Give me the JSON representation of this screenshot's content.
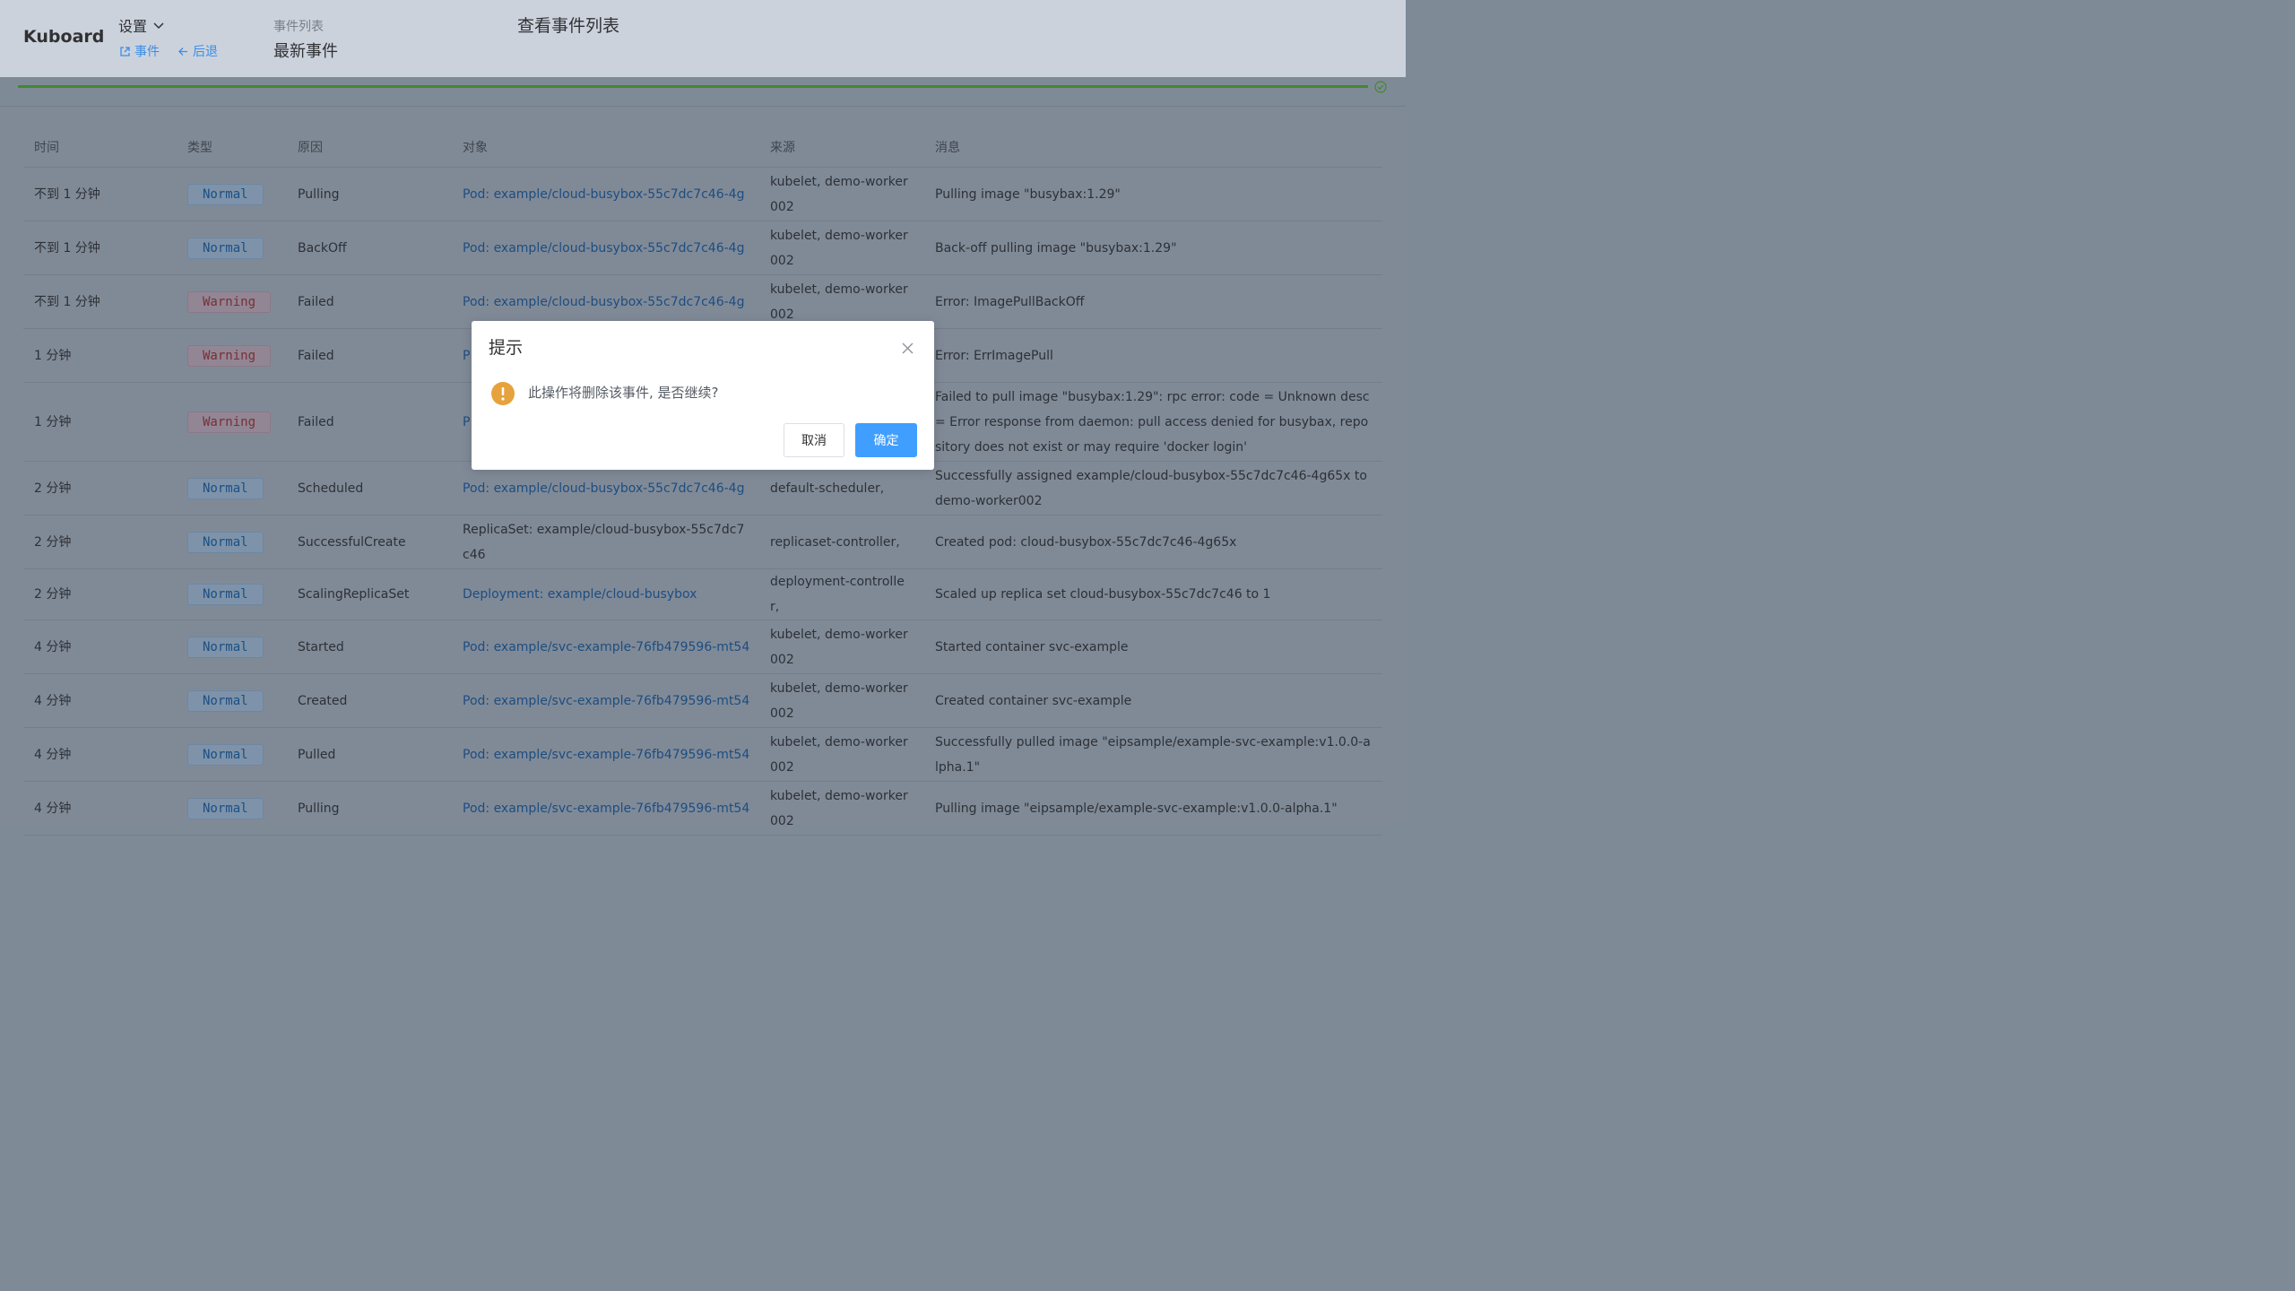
{
  "app": {
    "logo": "Kuboard",
    "settings_label": "设置",
    "links": {
      "events": "事件",
      "back": "后退"
    },
    "breadcrumb_sub": "事件列表",
    "breadcrumb_main": "最新事件",
    "page_title": "查看事件列表"
  },
  "progress": {
    "percent": 100,
    "status": "success",
    "color": "#3f8a2a"
  },
  "table": {
    "headers": {
      "time": "时间",
      "type": "类型",
      "reason": "原因",
      "object": "对象",
      "source": "来源",
      "message": "消息"
    },
    "rows": [
      {
        "time": "不到 1 分钟",
        "type": "Normal",
        "reason": "Pulling",
        "object": "Pod: example/cloud-busybox-55c7dc7c46-4g",
        "object_link": true,
        "source": "kubelet, demo-worker002",
        "message": "Pulling image \"busybax:1.29\""
      },
      {
        "time": "不到 1 分钟",
        "type": "Normal",
        "reason": "BackOff",
        "object": "Pod: example/cloud-busybox-55c7dc7c46-4g",
        "object_link": true,
        "source": "kubelet, demo-worker002",
        "message": "Back-off pulling image \"busybax:1.29\""
      },
      {
        "time": "不到 1 分钟",
        "type": "Warning",
        "reason": "Failed",
        "object": "Pod: example/cloud-busybox-55c7dc7c46-4g",
        "object_link": true,
        "source": "kubelet, demo-worker002",
        "message": "Error: ImagePullBackOff"
      },
      {
        "time": "1 分钟",
        "type": "Warning",
        "reason": "Failed",
        "object": "P",
        "object_link": true,
        "source": "",
        "message": "Error: ErrImagePull"
      },
      {
        "time": "1 分钟",
        "type": "Warning",
        "reason": "Failed",
        "object": "P",
        "object_link": true,
        "source": "",
        "message": "Failed to pull image \"busybax:1.29\": rpc error: code = Unknown desc = Error response from daemon: pull access denied for busybax, repository does not exist or may require 'docker login'"
      },
      {
        "time": "2 分钟",
        "type": "Normal",
        "reason": "Scheduled",
        "object": "Pod: example/cloud-busybox-55c7dc7c46-4g",
        "object_link": true,
        "source": "default-scheduler,",
        "message": "Successfully assigned example/cloud-busybox-55c7dc7c46-4g65x to demo-worker002"
      },
      {
        "time": "2 分钟",
        "type": "Normal",
        "reason": "SuccessfulCreate",
        "object": "ReplicaSet: example/cloud-busybox-55c7dc7c46",
        "object_link": false,
        "source": "replicaset-controller,",
        "message": "Created pod: cloud-busybox-55c7dc7c46-4g65x"
      },
      {
        "time": "2 分钟",
        "type": "Normal",
        "reason": "ScalingReplicaSet",
        "object": "Deployment: example/cloud-busybox",
        "object_link": true,
        "source": "deployment-controller,",
        "message": "Scaled up replica set cloud-busybox-55c7dc7c46 to 1"
      },
      {
        "time": "4 分钟",
        "type": "Normal",
        "reason": "Started",
        "object": "Pod: example/svc-example-76fb479596-mt54",
        "object_link": true,
        "source": "kubelet, demo-worker002",
        "message": "Started container svc-example"
      },
      {
        "time": "4 分钟",
        "type": "Normal",
        "reason": "Created",
        "object": "Pod: example/svc-example-76fb479596-mt54",
        "object_link": true,
        "source": "kubelet, demo-worker002",
        "message": "Created container svc-example"
      },
      {
        "time": "4 分钟",
        "type": "Normal",
        "reason": "Pulled",
        "object": "Pod: example/svc-example-76fb479596-mt54",
        "object_link": true,
        "source": "kubelet, demo-worker002",
        "message": "Successfully pulled image \"eipsample/example-svc-example:v1.0.0-alpha.1\""
      },
      {
        "time": "4 分钟",
        "type": "Normal",
        "reason": "Pulling",
        "object": "Pod: example/svc-example-76fb479596-mt54",
        "object_link": true,
        "source": "kubelet, demo-worker002",
        "message": "Pulling image \"eipsample/example-svc-example:v1.0.0-alpha.1\""
      }
    ]
  },
  "dialog": {
    "title": "提示",
    "message": "此操作将删除该事件, 是否继续?",
    "cancel_label": "取消",
    "confirm_label": "确定",
    "warn_color": "#e6a23c",
    "confirm_color": "#409eff"
  }
}
